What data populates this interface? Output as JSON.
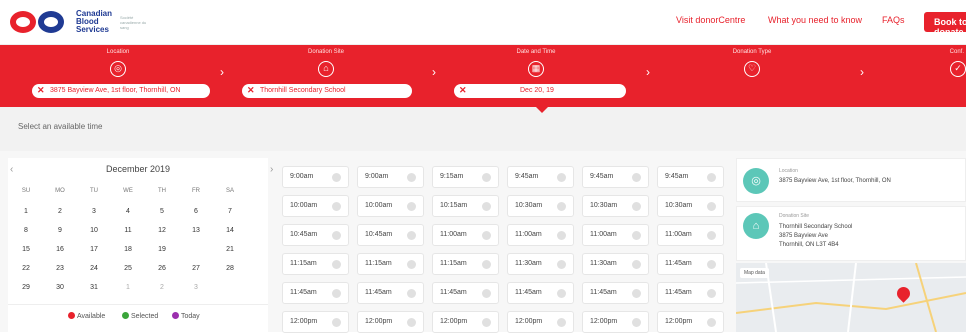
{
  "brand": {
    "name": "Canadian Blood Services",
    "sub": "Société canadienne du sang",
    "colors": {
      "primary": "#e8222c",
      "navy": "#1f3a93",
      "teal": "#5cc7b8",
      "available": "#e8222c",
      "selected": "#3aa53a",
      "today": "#9b2fae"
    }
  },
  "nav": {
    "links": [
      "Visit donorCentre",
      "What you need to know",
      "FAQs"
    ],
    "book_label": "Book to donate"
  },
  "steps": [
    {
      "title": "Location",
      "icon": "location-pin-icon",
      "value": "3875 Bayview Ave, 1st floor, Thornhill, ON"
    },
    {
      "title": "Donation Site",
      "icon": "building-icon",
      "value": "Thornhill Secondary School"
    },
    {
      "title": "Date and Time",
      "icon": "calendar-icon",
      "value": "Dec 20, 19"
    },
    {
      "title": "Donation Type",
      "icon": "heart-icon",
      "value": ""
    },
    {
      "title": "Conf.",
      "icon": "check-icon",
      "value": ""
    }
  ],
  "subbar": {
    "text": "Select an available time"
  },
  "calendar": {
    "month": "December 2019",
    "dow": [
      "SU",
      "MO",
      "TU",
      "WE",
      "TH",
      "FR",
      "SA"
    ],
    "weeks": [
      [
        "1",
        "2",
        "3",
        "4",
        "5",
        "6",
        "7"
      ],
      [
        "8",
        "9",
        "10",
        "11",
        "12",
        "13",
        "14"
      ],
      [
        "15",
        "16",
        "17",
        "18",
        "19",
        "20",
        "21"
      ],
      [
        "22",
        "23",
        "24",
        "25",
        "26",
        "27",
        "28"
      ],
      [
        "29",
        "30",
        "31",
        "1",
        "2",
        "3",
        ""
      ]
    ],
    "selected_day": "20",
    "legend": [
      {
        "label": "Available",
        "color": "#e8222c"
      },
      {
        "label": "Selected",
        "color": "#3aa53a"
      },
      {
        "label": "Today",
        "color": "#9b2fae"
      }
    ]
  },
  "slots": [
    [
      "9:00am",
      "9:00am",
      "9:15am",
      "9:45am",
      "9:45am",
      "9:45am"
    ],
    [
      "10:00am",
      "10:00am",
      "10:15am",
      "10:30am",
      "10:30am",
      "10:30am"
    ],
    [
      "10:45am",
      "10:45am",
      "11:00am",
      "11:00am",
      "11:00am",
      "11:00am"
    ],
    [
      "11:15am",
      "11:15am",
      "11:15am",
      "11:30am",
      "11:30am",
      "11:45am"
    ],
    [
      "11:45am",
      "11:45am",
      "11:45am",
      "11:45am",
      "11:45am",
      "11:45am"
    ],
    [
      "12:00pm",
      "12:00pm",
      "12:00pm",
      "12:00pm",
      "12:00pm",
      "12:00pm"
    ]
  ],
  "details": {
    "location_label": "Location",
    "location": "3875 Bayview Ave, 1st floor, Thornhill, ON",
    "site_label": "Donation Site",
    "site_lines": [
      "Thornhill Secondary School",
      "3875 Bayview Ave",
      "Thornhill, ON L3T 4B4"
    ],
    "map_tag": "Map data"
  }
}
